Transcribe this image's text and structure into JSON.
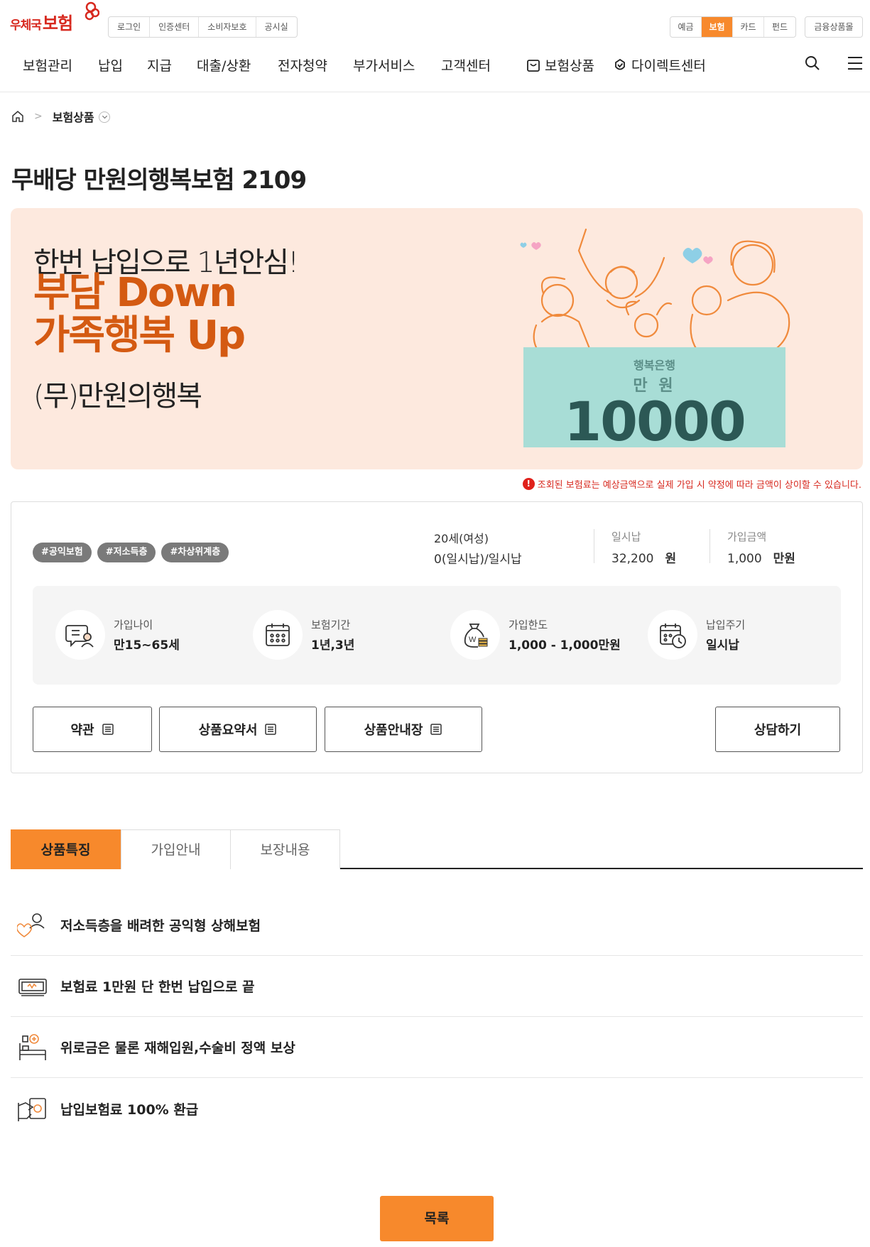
{
  "header": {
    "logo_small": "우체국",
    "logo_main": "보험",
    "util_links": [
      "로그인",
      "인증센터",
      "소비자보호",
      "공시실"
    ],
    "service_tabs": [
      "예금",
      "보험",
      "카드",
      "펀드"
    ],
    "active_service": "보험",
    "mall_label": "금융상품몰"
  },
  "nav": {
    "items": [
      "보험관리",
      "납입",
      "지급",
      "대출/상환",
      "전자청약",
      "부가서비스",
      "고객센터"
    ],
    "product_label": "보험상품",
    "direct_label": "다이렉트센터"
  },
  "breadcrumb": {
    "current": "보험상품"
  },
  "page_title": "무배당 만원의행복보험 2109",
  "banner": {
    "line1": "한번 납입으로 1년안심!",
    "line2": "부담 Down",
    "line3": "가족행복 Up",
    "line4": "(무)만원의행복",
    "bank_name": "행복은행",
    "bank_unit": "만 원",
    "bank_amount": "10000"
  },
  "notice": "조회된 보험료는 예상금액으로 실제 가입 시 약정에 따라 금액이 상이할 수 있습니다.",
  "product": {
    "tags": [
      "#공익보험",
      "#저소득층",
      "#차상위계층"
    ],
    "condition_line1": "20세(여성)",
    "condition_line2": "0(일시납)/일시납",
    "premium_label": "일시납",
    "premium_value": "32,200",
    "premium_unit": "원",
    "amount_label": "가입금액",
    "amount_value": "1,000",
    "amount_unit": "만원",
    "features": [
      {
        "label": "가입나이",
        "value": "만15~65세",
        "icon": "consult-person-icon"
      },
      {
        "label": "보험기간",
        "value": "1년,3년",
        "icon": "calendar-icon"
      },
      {
        "label": "가입한도",
        "value": "1,000 - 1,000만원",
        "icon": "money-bag-icon"
      },
      {
        "label": "납입주기",
        "value": "일시납",
        "icon": "calendar-clock-icon"
      }
    ],
    "buttons": {
      "terms": "약관",
      "summary": "상품요약서",
      "guide": "상품안내장",
      "consult": "상담하기"
    }
  },
  "tabs": {
    "items": [
      "상품특징",
      "가입안내",
      "보장내용"
    ],
    "active": "상품특징"
  },
  "feature_list": [
    {
      "text": "저소득층을 배려한 공익형 상해보험",
      "icon": "heart-person-icon"
    },
    {
      "text": "보험료 1만원 단 한번 납입으로 끝",
      "icon": "banknote-icon"
    },
    {
      "text": "위로금은 물론 재해입원,수술비 정액 보상",
      "icon": "hospital-bed-icon"
    },
    {
      "text": "납입보험료 100% 환급",
      "icon": "hand-money-icon"
    }
  ],
  "list_button": "목록",
  "colors": {
    "accent": "#f7892c",
    "brand_red": "#d7281e",
    "banner_bg": "#fde9de",
    "banner_text": "#d45a12"
  }
}
